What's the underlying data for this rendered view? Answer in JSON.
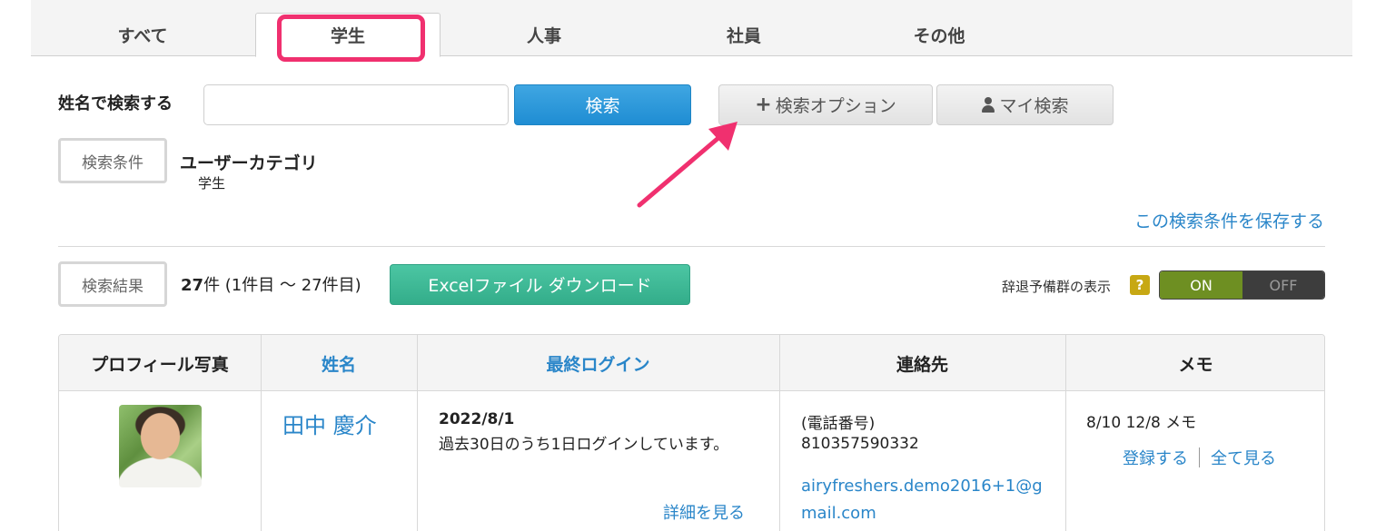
{
  "tabs": [
    {
      "label": "すべて",
      "active": false
    },
    {
      "label": "学生",
      "active": true
    },
    {
      "label": "人事",
      "active": false
    },
    {
      "label": "社員",
      "active": false
    },
    {
      "label": "その他",
      "active": false
    }
  ],
  "search": {
    "label": "姓名で検索する",
    "value": "",
    "button": "検索",
    "option_button": "検索オプション",
    "my_search_button": "マイ検索"
  },
  "conditions": {
    "label": "検索条件",
    "category_title": "ユーザーカテゴリ",
    "category_value": "学生",
    "save_link": "この検索条件を保存する"
  },
  "results": {
    "label": "検索結果",
    "count": "27",
    "count_suffix": "件 (1件目 ～ 27件目)",
    "excel_button": "Excelファイル ダウンロード",
    "toggle_label": "辞退予備群の表示",
    "help": "?",
    "toggle_on": "ON",
    "toggle_off": "OFF",
    "toggle_state": "ON"
  },
  "table": {
    "columns": [
      "プロフィール写真",
      "姓名",
      "最終ログイン",
      "連絡先",
      "メモ"
    ],
    "rows": [
      {
        "name": "田中 慶介",
        "last_login_date": "2022/8/1",
        "last_login_text": "過去30日のうち1日ログインしています。",
        "detail_link": "詳細を見る",
        "contact_label": "(電話番号)",
        "contact_phone": "810357590332",
        "contact_email": "airyfreshers.demo2016+1@gmail.com",
        "memo": "8/10 12/8 メモ",
        "memo_register": "登録する",
        "memo_view_all": "全て見る"
      }
    ]
  },
  "colors": {
    "accent_blue": "#2a86c9",
    "search_button": "#1f8dd3",
    "excel_button": "#33ad8a",
    "toggle_on": "#6e8f22",
    "highlight": "#f0306f",
    "help_badge": "#c7a814"
  },
  "icons": {
    "option_button": "plus-icon",
    "my_search_button": "person-icon",
    "annotation": "arrow-icon"
  }
}
